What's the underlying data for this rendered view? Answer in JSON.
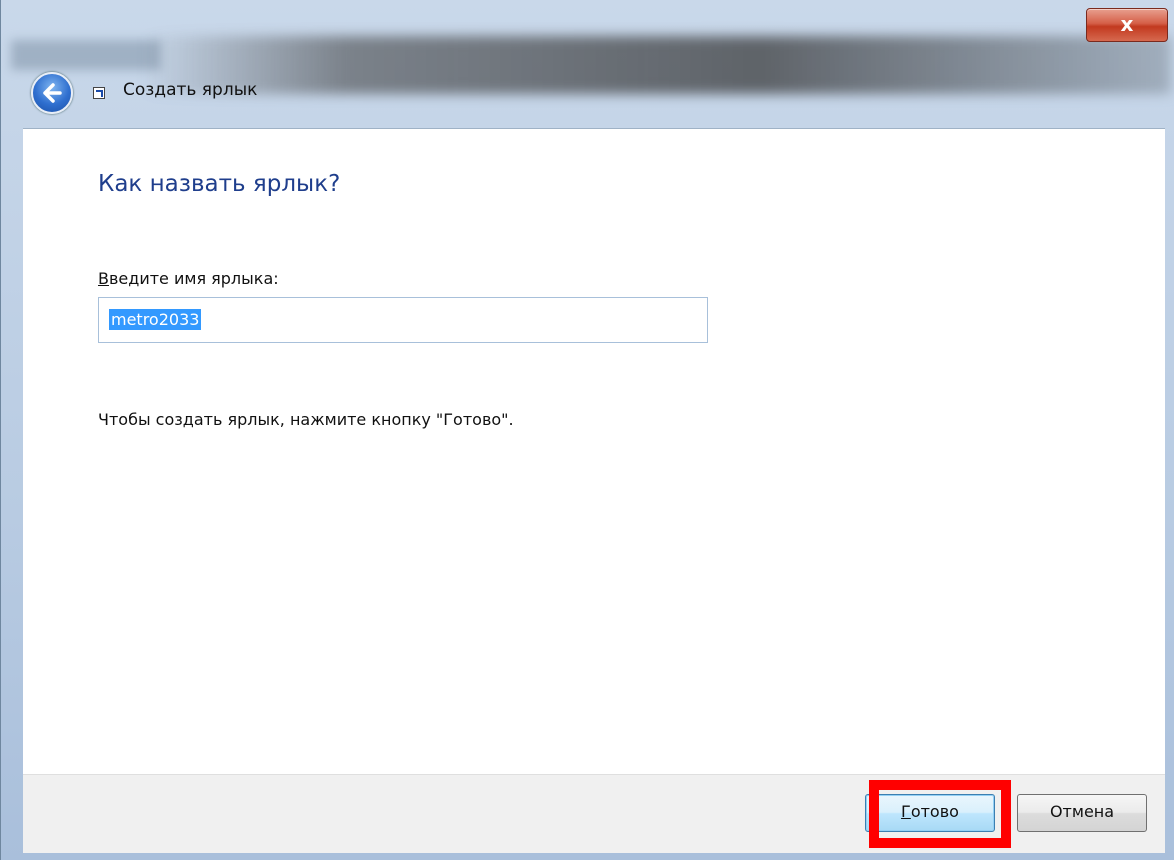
{
  "window": {
    "title": "Создать ярлык",
    "close_label": "x"
  },
  "icons": {
    "back": "back-arrow-icon",
    "shortcut": "shortcut-icon",
    "close": "close-icon"
  },
  "page": {
    "heading": "Как назвать ярлык?",
    "field_label_first": "В",
    "field_label_rest": "ведите имя ярлыка:",
    "input_value": "metro2033",
    "hint": "Чтобы создать ярлык, нажмите кнопку \"Готово\"."
  },
  "footer": {
    "finish_first": "Г",
    "finish_rest": "отово",
    "cancel_label": "Отмена"
  },
  "colors": {
    "heading": "#1f3e8c",
    "selection": "#3399ff",
    "highlight": "#ff0000"
  }
}
